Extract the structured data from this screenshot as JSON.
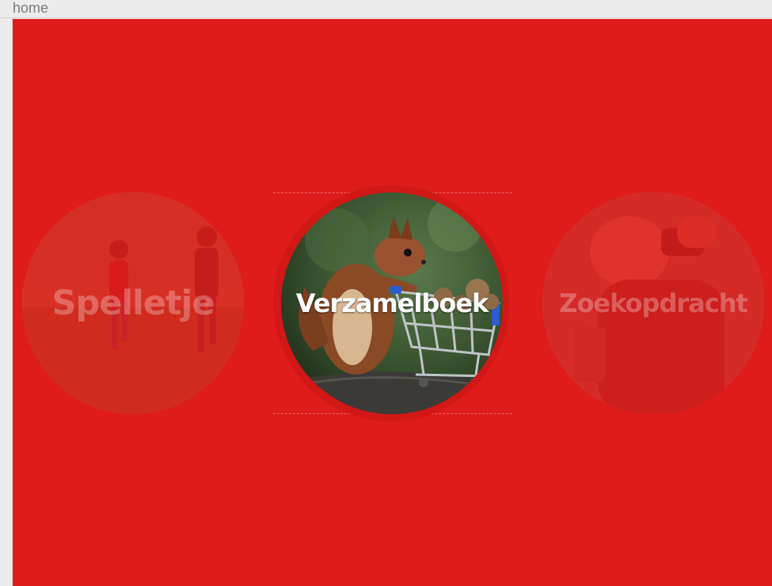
{
  "window": {
    "title": "home"
  },
  "theme": {
    "background": "#df1b1b",
    "ring": "#d21717"
  },
  "carousel": {
    "items": [
      {
        "label": "Spelletje",
        "state": "inactive",
        "photo": "children-running-in-field"
      },
      {
        "label": "Verzamelboek",
        "state": "active",
        "photo": "squirrel-with-shopping-cart"
      },
      {
        "label": "Zoekopdracht",
        "state": "inactive",
        "photo": "child-with-binoculars"
      }
    ]
  }
}
